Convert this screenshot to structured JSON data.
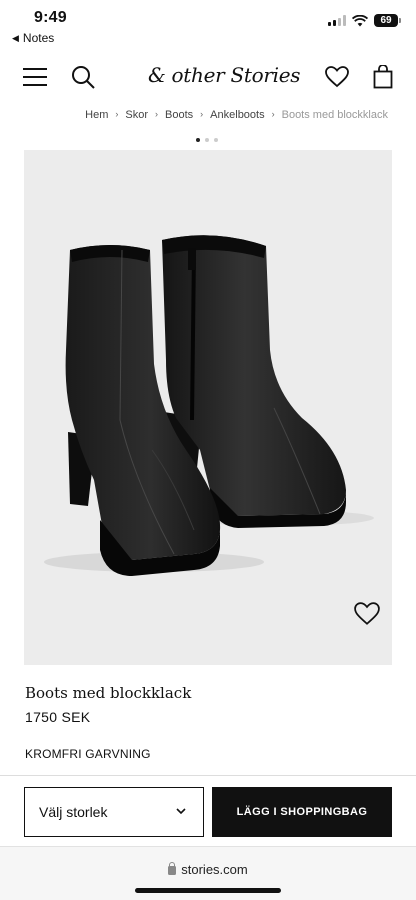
{
  "status_bar": {
    "time": "9:49",
    "battery": "69",
    "back_label": "Notes"
  },
  "header": {
    "logo": "& other Stories",
    "icons": [
      "menu-icon",
      "search-icon",
      "heart-icon",
      "bag-icon"
    ]
  },
  "breadcrumb": [
    "Hem",
    "Skor",
    "Boots",
    "Ankelboots",
    "Boots med blockklack"
  ],
  "carousel": {
    "total": 3,
    "active": 1
  },
  "product": {
    "title": "Boots med blockklack",
    "price": "1750 SEK",
    "tag": "KROMFRI GARVNING",
    "image_bg": "#ececec"
  },
  "actions": {
    "size_placeholder": "Välj storlek",
    "add_to_bag": "LÄGG I SHOPPINGBAG"
  },
  "browser": {
    "url": "stories.com"
  }
}
